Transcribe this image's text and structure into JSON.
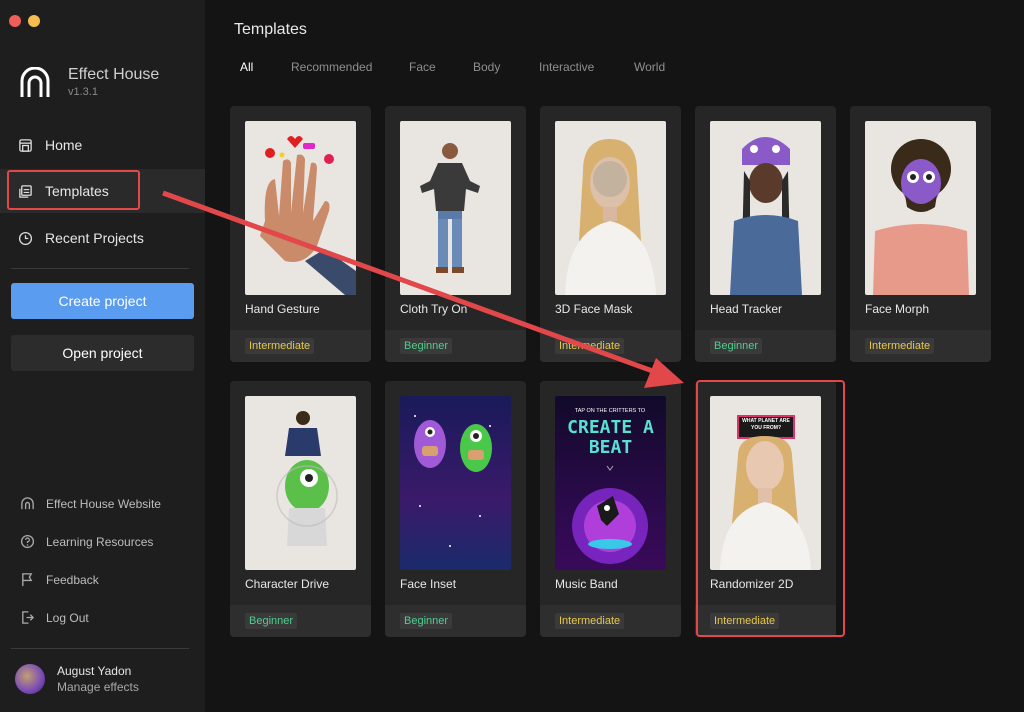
{
  "window": {
    "dot_colors": [
      "#ee5f57",
      "#f5be4f"
    ]
  },
  "app": {
    "name": "Effect House",
    "version": "v1.3.1"
  },
  "nav": [
    {
      "label": "Home",
      "icon": "home-icon"
    },
    {
      "label": "Templates",
      "icon": "templates-icon",
      "active": true
    },
    {
      "label": "Recent Projects",
      "icon": "clock-icon"
    }
  ],
  "actions": {
    "create": "Create project",
    "open": "Open project"
  },
  "footer_links": [
    {
      "label": "Effect House Website",
      "icon": "globe-icon"
    },
    {
      "label": "Learning Resources",
      "icon": "help-icon"
    },
    {
      "label": "Feedback",
      "icon": "flag-icon"
    },
    {
      "label": "Log Out",
      "icon": "logout-icon"
    }
  ],
  "user": {
    "name": "August Yadon",
    "subtitle": "Manage effects"
  },
  "main": {
    "title": "Templates",
    "tabs": [
      "All",
      "Recommended",
      "Face",
      "Body",
      "Interactive",
      "World"
    ],
    "active_tab": "All"
  },
  "templates": [
    {
      "title": "Hand Gesture",
      "level": "Intermediate"
    },
    {
      "title": "Cloth Try On",
      "level": "Beginner"
    },
    {
      "title": "3D Face Mask",
      "level": "Intermediate"
    },
    {
      "title": "Head Tracker",
      "level": "Beginner"
    },
    {
      "title": "Face Morph",
      "level": "Intermediate"
    },
    {
      "title": "Character Drive",
      "level": "Beginner"
    },
    {
      "title": "Face Inset",
      "level": "Beginner"
    },
    {
      "title": "Music Band",
      "level": "Intermediate"
    },
    {
      "title": "Randomizer 2D",
      "level": "Intermediate"
    }
  ],
  "thumb_text": {
    "music_band_top": "TAP ON THE CRITTERS TO",
    "music_band_big": "CREATE A BEAT",
    "randomizer_sign": "WHAT PLANET ARE YOU FROM?"
  },
  "colors": {
    "accent": "#5a9cf0",
    "highlight": "#e2474a",
    "intermediate": "#e8c84a",
    "beginner": "#4fcf8f"
  }
}
